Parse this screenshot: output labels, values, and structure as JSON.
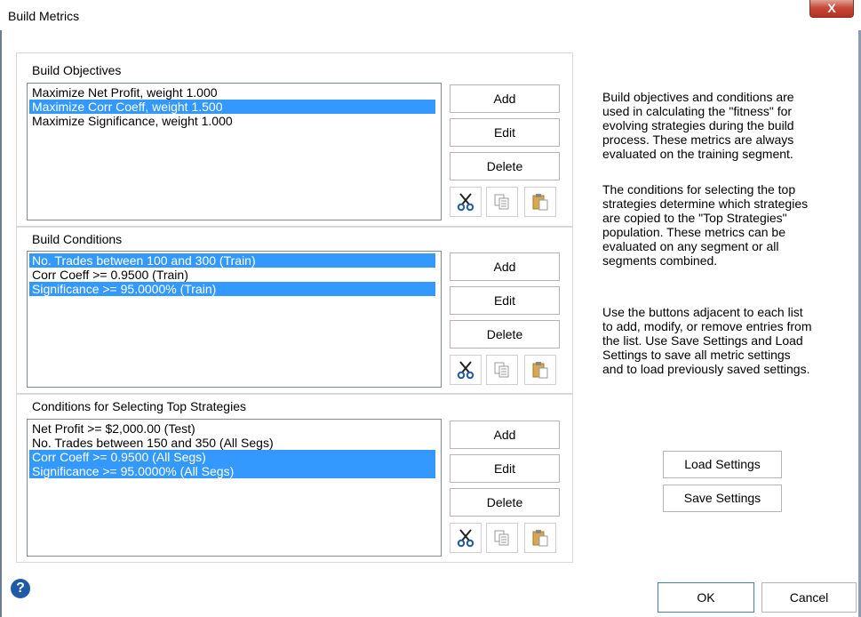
{
  "window": {
    "title": "Build Metrics",
    "close_label": "X"
  },
  "objectives": {
    "label": "Build Objectives",
    "items": [
      {
        "text": "Maximize Net Profit, weight 1.000",
        "selected": false
      },
      {
        "text": "Maximize Corr Coeff, weight 1.500",
        "selected": true
      },
      {
        "text": "Maximize Significance, weight 1.000",
        "selected": false
      }
    ],
    "add_label": "Add",
    "edit_label": "Edit",
    "delete_label": "Delete"
  },
  "conditions": {
    "label": "Build Conditions",
    "items": [
      {
        "text": "No. Trades between  100 and 300 (Train)",
        "selected": true
      },
      {
        "text": "Corr Coeff >=  0.9500 (Train)",
        "selected": false
      },
      {
        "text": "Significance >=  95.0000% (Train)",
        "selected": true
      }
    ],
    "add_label": "Add",
    "edit_label": "Edit",
    "delete_label": "Delete"
  },
  "top": {
    "label": "Conditions for Selecting Top Strategies",
    "items": [
      {
        "text": "Net Profit >=  $2,000.00 (Test)",
        "selected": false
      },
      {
        "text": "No. Trades between  150 and 350 (All Segs)",
        "selected": false
      },
      {
        "text": "Corr Coeff >=  0.9500 (All Segs)",
        "selected": true
      },
      {
        "text": "Significance >=  95.0000% (All Segs)",
        "selected": true
      }
    ],
    "add_label": "Add",
    "edit_label": "Edit",
    "delete_label": "Delete"
  },
  "help": {
    "p1": [
      "Build objectives and conditions are",
      "used in calculating the \"fitness\" for",
      "evolving strategies during the build",
      "process. These metrics are always",
      "evaluated on the training segment."
    ],
    "p2": [
      "The conditions for selecting the top",
      "strategies determine which strategies",
      "are copied to the \"Top Strategies\"",
      "population. These metrics can be",
      "evaluated on any segment or all",
      "segments combined."
    ],
    "p3": [
      "Use the buttons adjacent to each list",
      "to add, modify, or remove entries from",
      "the list. Use Save Settings and Load",
      "Settings to save all metric settings",
      "and to load previously saved settings."
    ]
  },
  "settings": {
    "load_label": "Load Settings",
    "save_label": "Save Settings"
  },
  "footer": {
    "ok_label": "OK",
    "cancel_label": "Cancel",
    "help_glyph": "?"
  },
  "icons": [
    "cut-icon",
    "copy-icon",
    "paste-icon"
  ]
}
